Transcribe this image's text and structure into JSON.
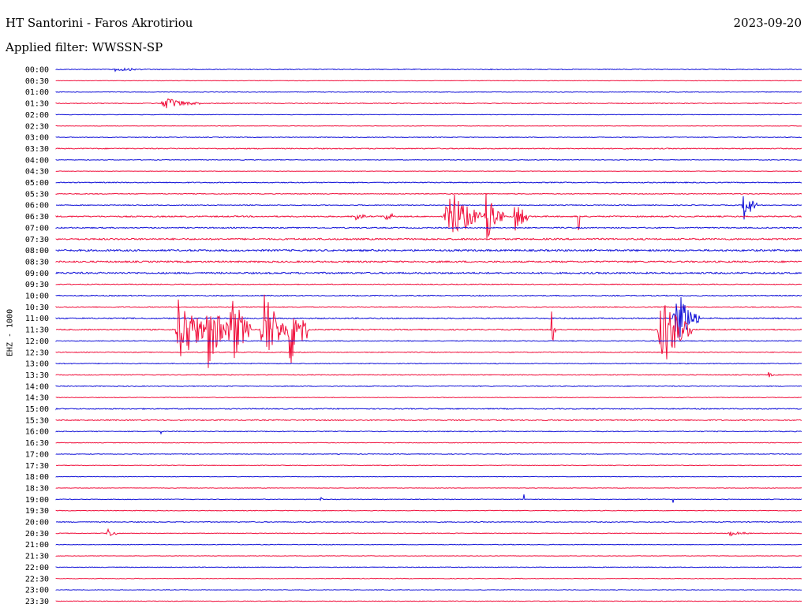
{
  "header": {
    "title": "HT Santorini - Faros Akrotiriou",
    "date": "2023-09-20",
    "filter": "Applied filter: WWSSN-SP"
  },
  "channel_label": "EHZ - 1000",
  "colors": {
    "blue": "#1010d8",
    "red": "#f0103c"
  },
  "chart_data": {
    "type": "line",
    "title": "HT Santorini - Faros Akrotiriou",
    "subtitle": "Applied filter: WWSSN-SP",
    "ylabel": "EHZ - 1000",
    "xlabel": "",
    "grid": false,
    "x_range_minutes": [
      0,
      30
    ],
    "row_labels": [
      "00:00",
      "00:30",
      "01:00",
      "01:30",
      "02:00",
      "02:30",
      "03:00",
      "03:30",
      "04:00",
      "04:30",
      "05:00",
      "05:30",
      "06:00",
      "06:30",
      "07:00",
      "07:30",
      "08:00",
      "08:30",
      "09:00",
      "09:30",
      "10:00",
      "10:30",
      "11:00",
      "11:30",
      "12:00",
      "12:30",
      "13:00",
      "13:30",
      "14:00",
      "14:30",
      "15:00",
      "15:30",
      "16:00",
      "16:30",
      "17:00",
      "17:30",
      "18:00",
      "18:30",
      "19:00",
      "19:30",
      "20:00",
      "20:30",
      "21:00",
      "21:30",
      "22:00",
      "22:30",
      "23:00",
      "23:30"
    ],
    "row_colors": "alternating blue/red starting with blue",
    "noise_level": [
      1,
      0.6,
      0.8,
      1,
      0.6,
      0.6,
      0.8,
      1.2,
      0.8,
      0.6,
      1.2,
      1,
      1,
      1.6,
      1.4,
      2,
      2.2,
      2,
      2,
      1,
      1.2,
      1,
      1.4,
      1.4,
      1,
      1,
      1,
      1,
      1,
      0.8,
      1.2,
      1.4,
      1,
      0.8,
      0.8,
      0.8,
      0.6,
      0.6,
      0.8,
      0.8,
      1,
      0.8,
      0.8,
      0.6,
      0.8,
      0.8,
      0.8,
      0.8
    ],
    "events": [
      {
        "row": "00:00",
        "start_min": 2.2,
        "duration_min": 1.4,
        "amplitude": 3
      },
      {
        "row": "01:30",
        "start_min": 4.2,
        "duration_min": 1.6,
        "amplitude": 7
      },
      {
        "row": "06:30",
        "start_min": 12.0,
        "duration_min": 0.5,
        "amplitude": 6
      },
      {
        "row": "06:30",
        "start_min": 13.2,
        "duration_min": 0.6,
        "amplitude": 6
      },
      {
        "row": "06:30",
        "start_min": 15.6,
        "duration_min": 1.5,
        "amplitude": 40
      },
      {
        "row": "06:30",
        "start_min": 17.2,
        "duration_min": 0.8,
        "amplitude": 38
      },
      {
        "row": "06:30",
        "start_min": 18.4,
        "duration_min": 0.6,
        "amplitude": 28
      },
      {
        "row": "06:30",
        "start_min": 21.0,
        "duration_min": 0.1,
        "amplitude": 40
      },
      {
        "row": "06:00",
        "start_min": 27.6,
        "duration_min": 0.6,
        "amplitude": 22
      },
      {
        "row": "11:30",
        "start_min": 4.8,
        "duration_min": 1.2,
        "amplitude": 60
      },
      {
        "row": "11:30",
        "start_min": 6.0,
        "duration_min": 0.9,
        "amplitude": 55
      },
      {
        "row": "11:30",
        "start_min": 6.9,
        "duration_min": 1.0,
        "amplitude": 50
      },
      {
        "row": "11:30",
        "start_min": 8.2,
        "duration_min": 1.1,
        "amplitude": 55
      },
      {
        "row": "11:30",
        "start_min": 9.3,
        "duration_min": 0.9,
        "amplitude": 55
      },
      {
        "row": "11:30",
        "start_min": 19.9,
        "duration_min": 0.2,
        "amplitude": 30
      },
      {
        "row": "11:30",
        "start_min": 24.2,
        "duration_min": 1.4,
        "amplitude": 50
      },
      {
        "row": "11:00",
        "start_min": 24.8,
        "duration_min": 1.1,
        "amplitude": 40
      },
      {
        "row": "13:30",
        "start_min": 28.6,
        "duration_min": 0.3,
        "amplitude": 6
      },
      {
        "row": "16:00",
        "start_min": 4.2,
        "duration_min": 0.05,
        "amplitude": 15
      },
      {
        "row": "19:00",
        "start_min": 10.6,
        "duration_min": 0.2,
        "amplitude": 4
      },
      {
        "row": "19:00",
        "start_min": 18.8,
        "duration_min": 0.05,
        "amplitude": 20
      },
      {
        "row": "19:00",
        "start_min": 24.8,
        "duration_min": 0.05,
        "amplitude": 18
      },
      {
        "row": "20:30",
        "start_min": 2.0,
        "duration_min": 0.5,
        "amplitude": 7
      },
      {
        "row": "20:30",
        "start_min": 27.0,
        "duration_min": 1.0,
        "amplitude": 3
      }
    ]
  }
}
